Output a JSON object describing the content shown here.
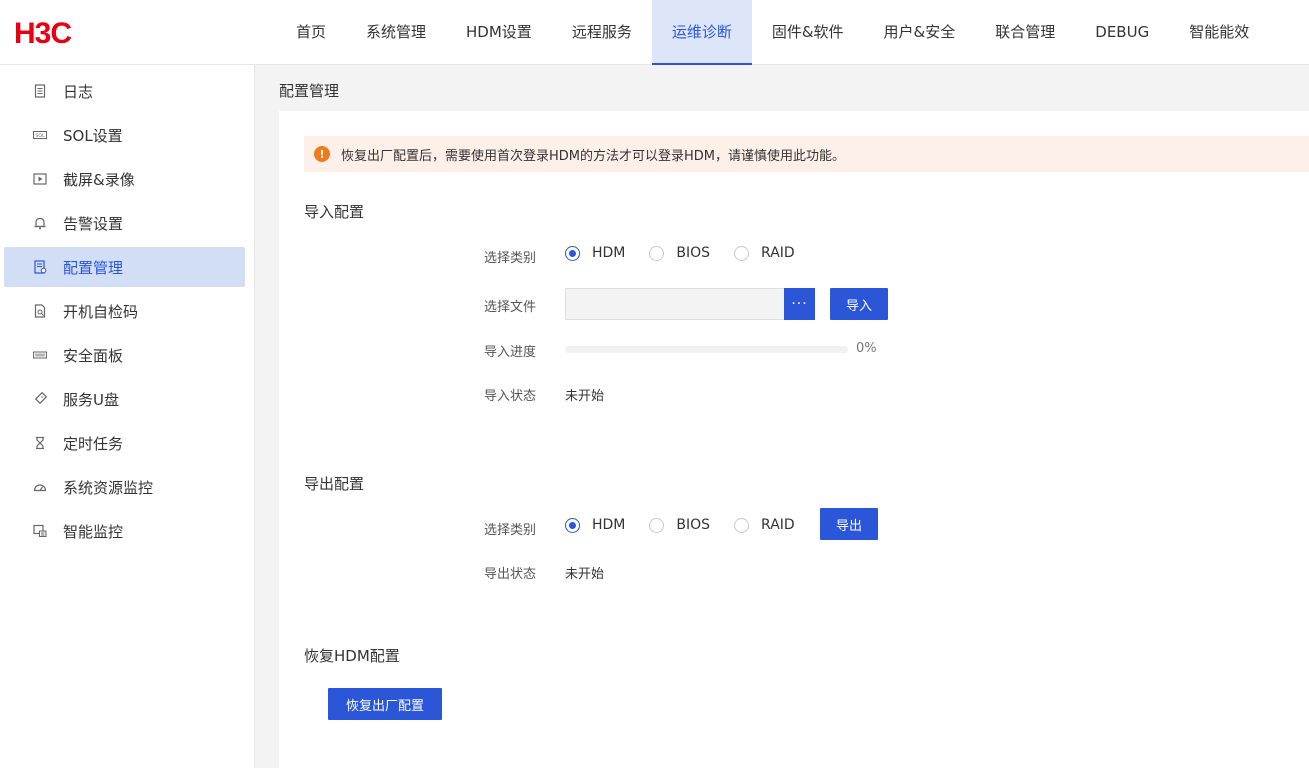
{
  "brand": {
    "logo_text": "H3C",
    "logo_color": "#e60012",
    "accent": "#2b56d8"
  },
  "topnav": {
    "items": [
      {
        "label": "首页"
      },
      {
        "label": "系统管理"
      },
      {
        "label": "HDM设置"
      },
      {
        "label": "远程服务"
      },
      {
        "label": "运维诊断",
        "active": true
      },
      {
        "label": "固件&软件"
      },
      {
        "label": "用户&安全"
      },
      {
        "label": "联合管理"
      },
      {
        "label": "DEBUG"
      },
      {
        "label": "智能能效"
      }
    ]
  },
  "sidebar": {
    "items": [
      {
        "label": "日志",
        "icon": "log-icon"
      },
      {
        "label": "SOL设置",
        "icon": "sol-icon"
      },
      {
        "label": "截屏&录像",
        "icon": "video-icon"
      },
      {
        "label": "告警设置",
        "icon": "bell-icon"
      },
      {
        "label": "配置管理",
        "icon": "config-icon",
        "active": true
      },
      {
        "label": "开机自检码",
        "icon": "post-code-icon"
      },
      {
        "label": "安全面板",
        "icon": "panel-icon"
      },
      {
        "label": "服务U盘",
        "icon": "usb-icon"
      },
      {
        "label": "定时任务",
        "icon": "hourglass-icon"
      },
      {
        "label": "系统资源监控",
        "icon": "gauge-icon"
      },
      {
        "label": "智能监控",
        "icon": "monitor-icon"
      }
    ]
  },
  "page": {
    "breadcrumb": "配置管理",
    "notice": "恢复出厂配置后，需要使用首次登录HDM的方法才可以登录HDM，请谨慎使用此功能。",
    "import": {
      "title": "导入配置",
      "category_label": "选择类别",
      "file_label": "选择文件",
      "file_button": "···",
      "import_button": "导入",
      "progress_label": "导入进度",
      "progress_value": 0,
      "progress_text": "0%",
      "status_label": "导入状态",
      "status_value": "未开始"
    },
    "export": {
      "title": "导出配置",
      "category_label": "选择类别",
      "export_button": "导出",
      "status_label": "导出状态",
      "status_value": "未开始"
    },
    "restore": {
      "title": "恢复HDM配置",
      "restore_button": "恢复出厂配置"
    },
    "radio_options": [
      "HDM",
      "BIOS",
      "RAID"
    ],
    "radio_selected": "HDM"
  }
}
